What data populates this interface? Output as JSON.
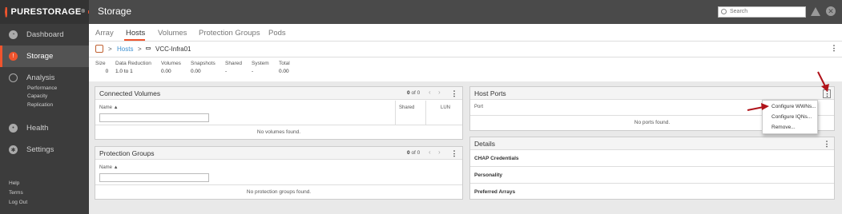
{
  "brand": {
    "name": "PURESTORAGE",
    "reg": "®"
  },
  "sidebar": {
    "items": [
      {
        "label": "Dashboard",
        "icon": "dashboard-icon"
      },
      {
        "label": "Storage",
        "icon": "storage-icon"
      },
      {
        "label": "Analysis",
        "icon": "analysis-icon"
      },
      {
        "label": "Health",
        "icon": "health-icon"
      },
      {
        "label": "Settings",
        "icon": "settings-icon"
      }
    ],
    "analysis_sub": [
      "Performance",
      "Capacity",
      "Replication"
    ],
    "footer": [
      "Help",
      "Terms",
      "Log Out"
    ]
  },
  "header": {
    "title": "Storage",
    "search_placeholder": "Search"
  },
  "tabs": [
    "Array",
    "Hosts",
    "Volumes",
    "Protection Groups",
    "Pods"
  ],
  "breadcrumb": {
    "sep1": ">",
    "link": "Hosts",
    "sep2": ">",
    "host": "VCC-Infra01"
  },
  "stats": [
    {
      "label": "Size",
      "value": "0"
    },
    {
      "label": "Data Reduction",
      "value": "1.0 to 1"
    },
    {
      "label": "Volumes",
      "value": "0.00"
    },
    {
      "label": "Snapshots",
      "value": "0.00"
    },
    {
      "label": "Shared",
      "value": "-"
    },
    {
      "label": "System",
      "value": "-"
    },
    {
      "label": "Total",
      "value": "0.00"
    }
  ],
  "connected_volumes": {
    "title": "Connected Volumes",
    "count": "0",
    "of": "of 0",
    "col_name": "Name ▲",
    "col_shared": "Shared",
    "col_lun": "LUN",
    "empty": "No volumes found."
  },
  "protection_groups": {
    "title": "Protection Groups",
    "count": "0",
    "of": "of 0",
    "col_name": "Name ▲",
    "empty": "No protection groups found."
  },
  "host_ports": {
    "title": "Host Ports",
    "col_port": "Port",
    "empty": "No ports found."
  },
  "details": {
    "title": "Details",
    "rows": [
      "CHAP Credentials",
      "Personality",
      "Preferred Arrays"
    ]
  },
  "menu": {
    "items": [
      "Configure WWNs...",
      "Configure IQNs...",
      "Remove..."
    ]
  },
  "colors": {
    "accent": "#f0542d",
    "link": "#3a8fd0",
    "annotation": "#b0131a"
  }
}
